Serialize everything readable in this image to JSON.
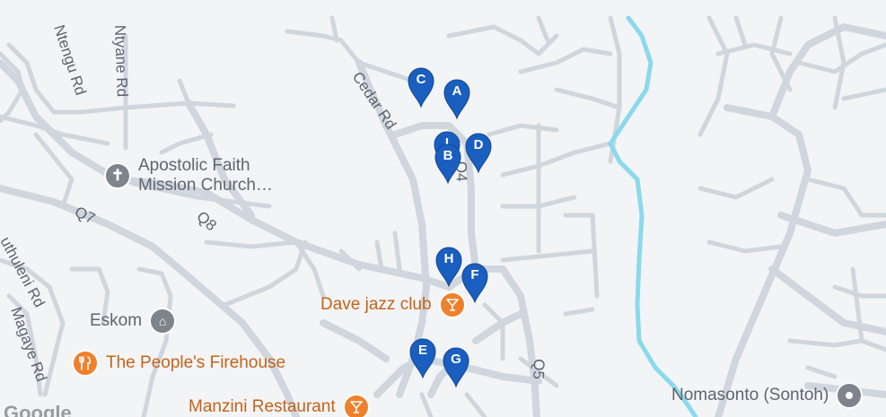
{
  "map": {
    "colors": {
      "background": "#f3f4f5",
      "road": "#cfd6dd",
      "river": "#8ad9ec",
      "pin": "#1a5fbf",
      "poi_grey": "#7d848c",
      "poi_orange": "#f0802c"
    },
    "road_labels": {
      "ntengu": "Ntengu Rd",
      "ntyane": "Ntyane Rd",
      "cedar": "Cedar Rd",
      "q4": "Q4",
      "q7": "Q7",
      "q8": "Q8",
      "q5": "Q5",
      "buthuleni": "uthuleni Rd",
      "magaye": "Magaye Rd"
    },
    "pois": {
      "church": {
        "line1": "Apostolic Faith",
        "line2": "Mission Church…",
        "icon": "cross-icon"
      },
      "eskom": {
        "label": "Eskom",
        "icon": "building-icon"
      },
      "firehouse": {
        "label": "The People's Firehouse",
        "icon": "restaurant-icon"
      },
      "dave_jazz": {
        "label": "Dave jazz club",
        "icon": "cocktail-icon"
      },
      "manzini": {
        "label": "Manzini Restaurant",
        "icon": "cocktail-icon"
      },
      "nomasonto": {
        "label": "Nomasonto (Sontoh)",
        "icon": "location-icon"
      }
    },
    "markers": {
      "a": "A",
      "b": "B",
      "c": "C",
      "d": "D",
      "e": "E",
      "f": "F",
      "g": "G",
      "h": "H",
      "i": "I"
    },
    "logo": "Google"
  }
}
